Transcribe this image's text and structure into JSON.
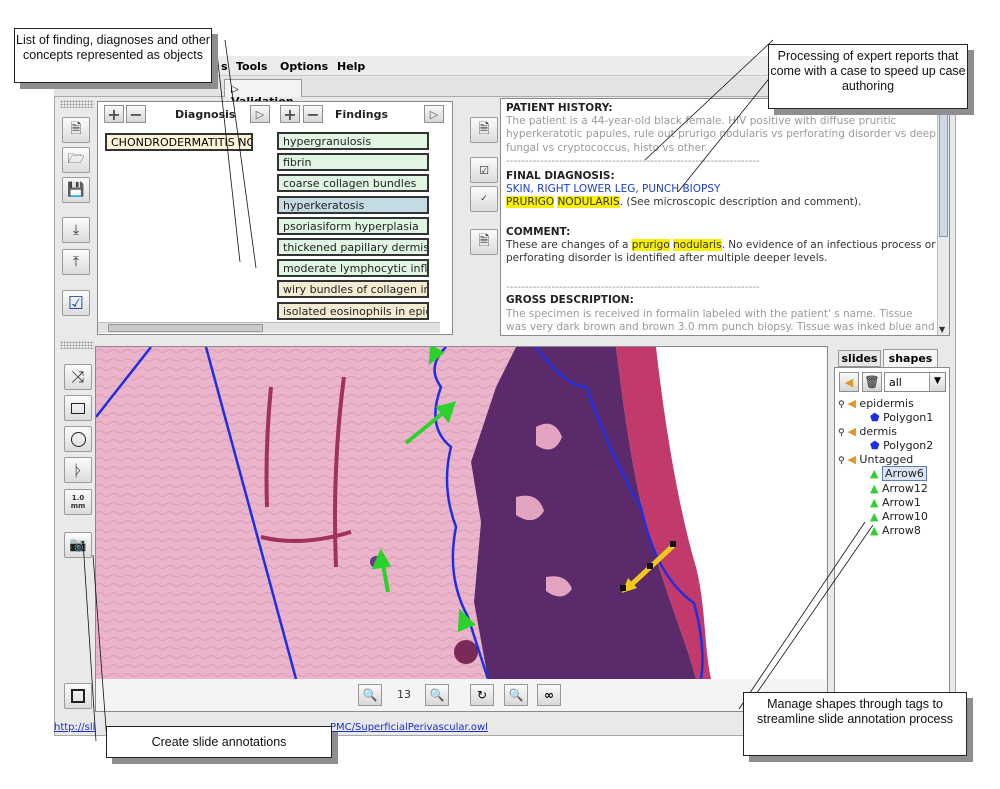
{
  "menu": {
    "items": [
      "s",
      "Tools",
      "Options",
      "Help"
    ]
  },
  "tabs": {
    "validation": "Validation"
  },
  "diagnosis_panel": {
    "header": "Diagnosis",
    "items": [
      "CHONDRODERMATITIS NOD"
    ]
  },
  "findings_panel": {
    "header": "Findings",
    "items": [
      {
        "label": "hypergranulosis",
        "tone": "green"
      },
      {
        "label": "fibrin",
        "tone": "green"
      },
      {
        "label": "coarse collagen bundles",
        "tone": "green"
      },
      {
        "label": "hyperkeratosis",
        "tone": "selected"
      },
      {
        "label": "psoriasiform hyperplasia",
        "tone": "green"
      },
      {
        "label": "thickened papillary dermis",
        "tone": "green"
      },
      {
        "label": "moderate lymphocytic inflam",
        "tone": "green"
      },
      {
        "label": "wiry bundles of collagen in u",
        "tone": "tan"
      },
      {
        "label": "isolated eosinophils in epide",
        "tone": "tan"
      }
    ]
  },
  "report": {
    "history_heading": "PATIENT HISTORY:",
    "history_text": "The patient is a 44-year-old black female. HIV positive with diffuse pruritic hyperkeratotic papules, rule out prurigo nodularis vs perforating disorder vs deep fungal vs cryptococcus, histo vs other.",
    "divider": "-------------------------------------------------------------------",
    "final_heading": "FINAL DIAGNOSIS:",
    "site": "SKIN, RIGHT LOWER LEG, PUNCH BIOPSY",
    "hl1": "PRURIGO",
    "hl2": "NODULARIS",
    "final_rest": ".  (See microscopic description and comment).",
    "comment_heading": "COMMENT:",
    "comment_pre": "These are changes of a ",
    "comment_hl1": "prurigo",
    "comment_hl2": "nodularis",
    "comment_post": ".  No evidence of an infectious process or perforating disorder is identified after multiple deeper levels.",
    "gross_heading": "GROSS DESCRIPTION:",
    "gross_text": "The specimen is received in formalin labeled with the patient' s name.  Tissue was very dark brown and brown 3.0 mm punch biopsy.  Tissue was inked blue and"
  },
  "scale_label": {
    "top": "1.0",
    "bottom": "mm"
  },
  "viewer": {
    "zoom_level": "13"
  },
  "shapes_panel": {
    "tabs": [
      "slides",
      "shapes"
    ],
    "filter": "all",
    "tree": [
      {
        "tag": "epidermis",
        "children": [
          "Polygon1"
        ]
      },
      {
        "tag": "dermis",
        "children": [
          "Polygon2"
        ]
      },
      {
        "tag": "Untagged",
        "children": [
          "Arrow6",
          "Arrow12",
          "Arrow1",
          "Arrow10",
          "Arrow8"
        ]
      }
    ]
  },
  "status": {
    "url_left": "http://sli",
    "url_right": "PMC/SuperficialPerivascular.owl"
  },
  "callouts": {
    "objects": "List of finding, diagnoses and other concepts represented as objects",
    "reports": "Processing of expert reports that come with a case to speed up case authoring",
    "annotations": "Create slide annotations",
    "shapes": "Manage shapes through tags to streamline slide annotation process"
  },
  "colors": {
    "polygon": "#1f2fe0",
    "arrow_green": "#2cd12c",
    "arrow_yellow": "#f2c81b",
    "highlight": "#f8f000",
    "tissue_pink": "#e8a6c0",
    "tissue_purple": "#5a2a6a"
  }
}
